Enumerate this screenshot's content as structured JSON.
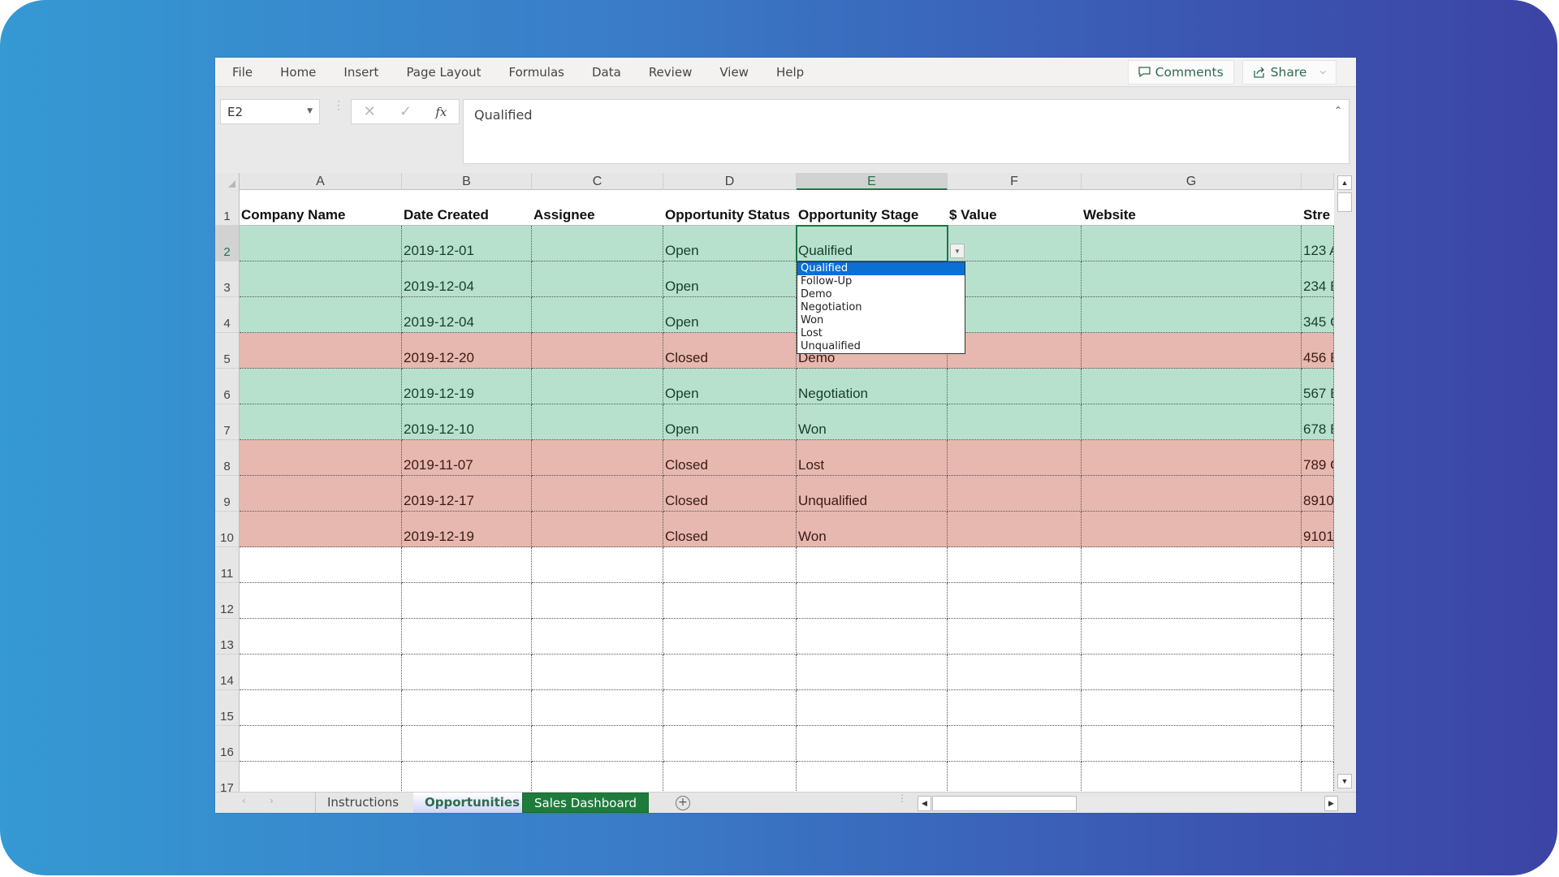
{
  "menu": {
    "items": [
      "File",
      "Home",
      "Insert",
      "Page Layout",
      "Formulas",
      "Data",
      "Review",
      "View",
      "Help"
    ],
    "comments_label": "Comments",
    "share_label": "Share"
  },
  "formula_bar": {
    "name_box": "E2",
    "fx_label": "fx",
    "value": "Qualified"
  },
  "columns": [
    "A",
    "B",
    "C",
    "D",
    "E",
    "F",
    "G",
    ""
  ],
  "active_column": "E",
  "active_row": 2,
  "headers": [
    "Company Name",
    "Date Created",
    "Assignee",
    "Opportunity Status",
    "Opportunity Stage",
    "$ Value",
    "Website",
    "Stre"
  ],
  "rows": [
    {
      "num": "2",
      "status_color": "green",
      "cells": [
        "",
        "2019-12-01",
        "",
        "Open",
        "Qualified",
        "",
        "",
        "123 A"
      ]
    },
    {
      "num": "3",
      "status_color": "green",
      "cells": [
        "",
        "2019-12-04",
        "",
        "Open",
        "",
        "",
        "",
        "234 E"
      ]
    },
    {
      "num": "4",
      "status_color": "green",
      "cells": [
        "",
        "2019-12-04",
        "",
        "Open",
        "",
        "",
        "",
        "345 C"
      ]
    },
    {
      "num": "5",
      "status_color": "red",
      "cells": [
        "",
        "2019-12-20",
        "",
        "Closed",
        "Demo",
        "",
        "",
        "456 E"
      ]
    },
    {
      "num": "6",
      "status_color": "green",
      "cells": [
        "",
        "2019-12-19",
        "",
        "Open",
        "Negotiation",
        "",
        "",
        "567 E"
      ]
    },
    {
      "num": "7",
      "status_color": "green",
      "cells": [
        "",
        "2019-12-10",
        "",
        "Open",
        "Won",
        "",
        "",
        "678 E"
      ]
    },
    {
      "num": "8",
      "status_color": "red",
      "cells": [
        "",
        "2019-11-07",
        "",
        "Closed",
        "Lost",
        "",
        "",
        "789 C"
      ]
    },
    {
      "num": "9",
      "status_color": "red",
      "cells": [
        "",
        "2019-12-17",
        "",
        "Closed",
        "Unqualified",
        "",
        "",
        "8910"
      ]
    },
    {
      "num": "10",
      "status_color": "red",
      "cells": [
        "",
        "2019-12-19",
        "",
        "Closed",
        "Won",
        "",
        "",
        "9101"
      ]
    }
  ],
  "empty_rows": [
    "11",
    "12",
    "13",
    "14",
    "15",
    "16",
    "17"
  ],
  "dropdown": {
    "selected": "Qualified",
    "options": [
      "Qualified",
      "Follow-Up",
      "Demo",
      "Negotiation",
      "Won",
      "Lost",
      "Unqualified"
    ]
  },
  "sheet_tabs": [
    {
      "label": "Instructions",
      "state": "normal"
    },
    {
      "label": "Opportunities",
      "state": "active"
    },
    {
      "label": "Sales Dashboard",
      "state": "green"
    }
  ],
  "colors": {
    "open_row": "#b7e1cd",
    "closed_row": "#e6b8af",
    "excel_green": "#217346",
    "dropdown_highlight": "#0b6fd4"
  }
}
